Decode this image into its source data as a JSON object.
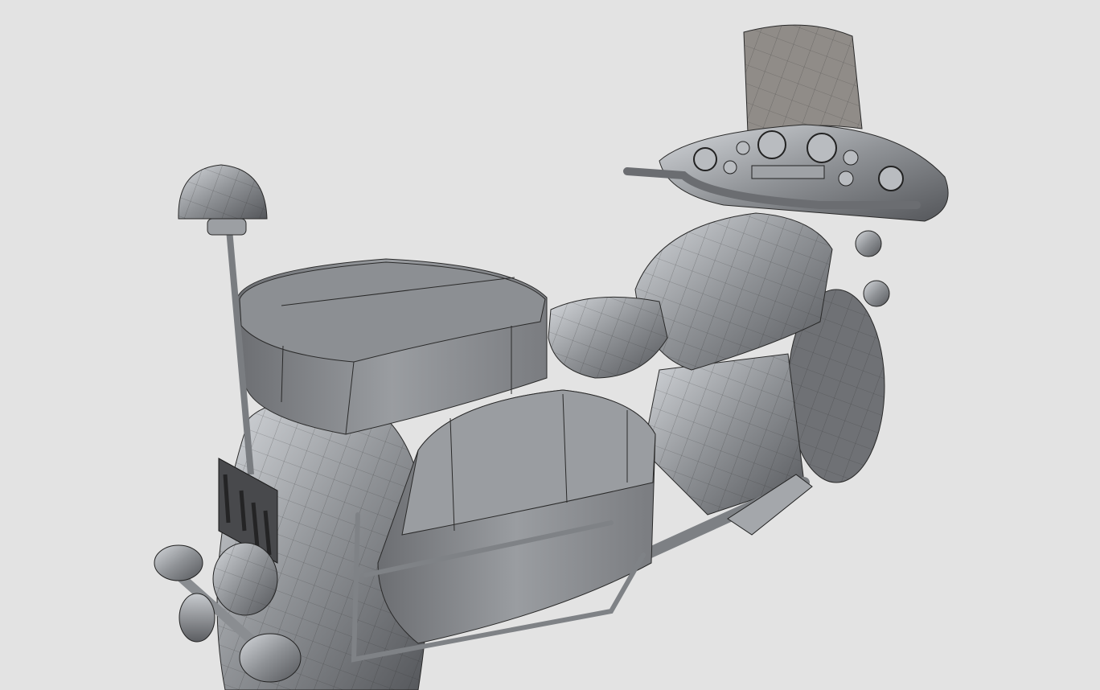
{
  "scene": {
    "subject": "motorcycle-3d-model",
    "colors": {
      "background": "#e3e3e3",
      "metal_light": "#c9ccd0",
      "metal_mid": "#8a8d91",
      "metal_dark": "#4a4c50",
      "edge": "#2a2a2a",
      "windshield": "#8e8a86"
    }
  }
}
